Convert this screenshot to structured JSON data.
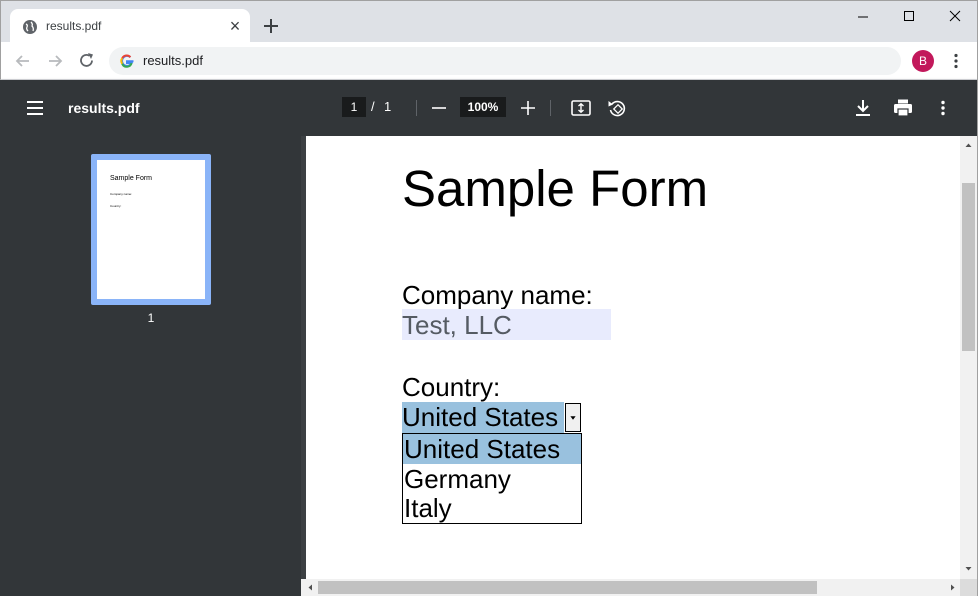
{
  "browser": {
    "tab_title": "results.pdf",
    "tab_close": "×",
    "url": "results.pdf",
    "profile_initial": "B",
    "profile_color": "#c2185b",
    "icons": {
      "favicon": "globe-icon",
      "new_tab": "plus-icon",
      "minimize": "minimize-icon",
      "maximize": "maximize-icon",
      "close": "close-icon",
      "back": "arrow-left-icon",
      "forward": "arrow-right-icon",
      "reload": "reload-icon",
      "site": "google-g-icon",
      "menu": "kebab-menu-icon"
    }
  },
  "pdf_viewer": {
    "title": "results.pdf",
    "current_page": "1",
    "page_separator": "/",
    "total_pages": "1",
    "zoom": "100%",
    "toolbar_color": "#323639",
    "thumbnail": {
      "page_number": "1",
      "highlight_color": "#8ab4f8"
    },
    "icons": {
      "menu": "hamburger-icon",
      "zoom_out": "minus-icon",
      "zoom_in": "plus-icon",
      "fit": "fit-page-icon",
      "rotate": "rotate-icon",
      "download": "download-icon",
      "print": "print-icon",
      "more": "kebab-menu-icon"
    }
  },
  "document": {
    "title": "Sample Form",
    "company_label": "Company name:",
    "company_value": "Test, LLC",
    "country_label": "Country:",
    "country_selected": "United States",
    "country_options": [
      "United States",
      "Germany",
      "Italy"
    ],
    "field_bg_color": "#e8ebfd",
    "selection_color": "#99c1de"
  }
}
